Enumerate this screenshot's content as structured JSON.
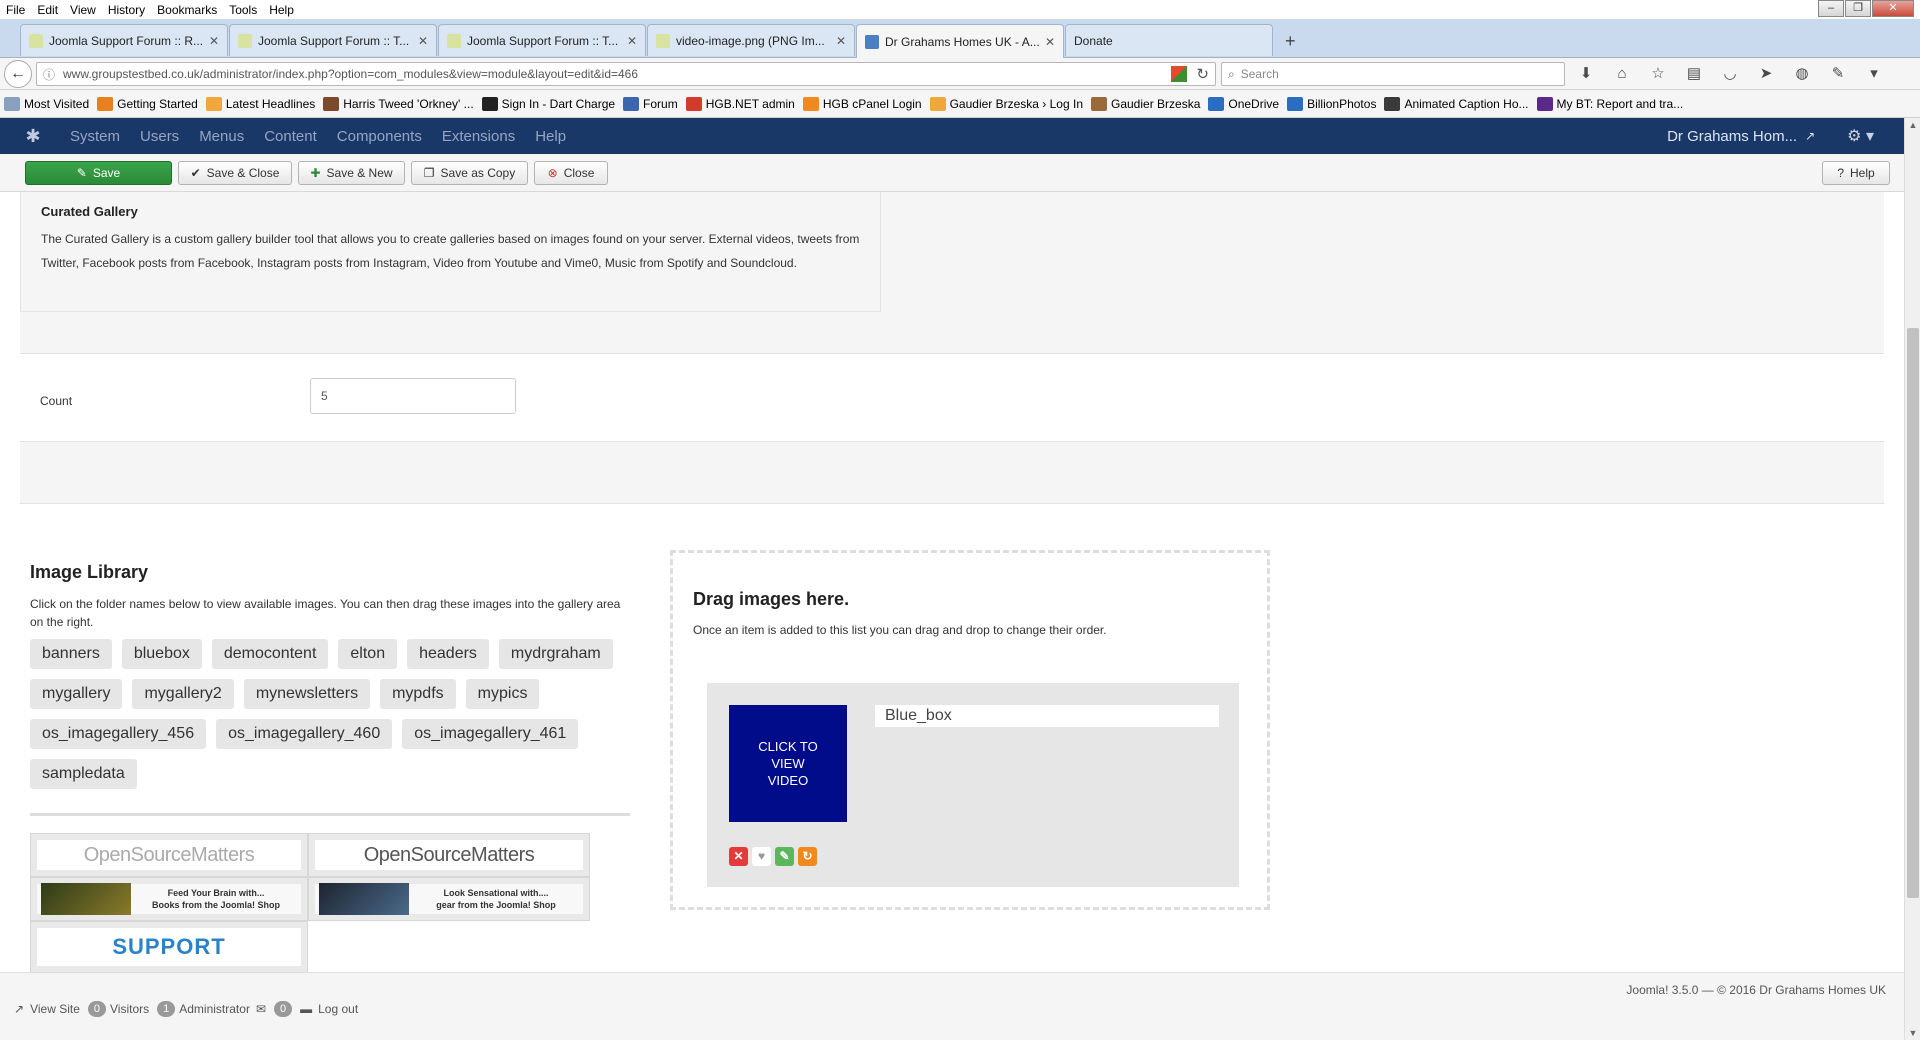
{
  "menubar": [
    "File",
    "Edit",
    "View",
    "History",
    "Bookmarks",
    "Tools",
    "Help"
  ],
  "tabs": [
    {
      "label": "Joomla Support Forum :: R...",
      "color": "#d8e3a2"
    },
    {
      "label": "Joomla Support Forum :: T...",
      "color": "#d8e3a2"
    },
    {
      "label": "Joomla Support Forum :: T...",
      "color": "#d8e3a2"
    },
    {
      "label": "video-image.png (PNG Im...",
      "color": "#d8e3a2"
    },
    {
      "label": "Dr Grahams Homes UK - A...",
      "color": "#4a7fc1"
    },
    {
      "label": "Donate",
      "color": "#f5f5f5"
    }
  ],
  "nav": {
    "url": "www.groupstestbed.co.uk/administrator/index.php?option=com_modules&view=module&layout=edit&id=466",
    "search_placeholder": "Search"
  },
  "bookmarks": [
    {
      "label": "Most Visited",
      "color": "#8aa0c0"
    },
    {
      "label": "Getting Started",
      "color": "#e5811f"
    },
    {
      "label": "Latest Headlines",
      "color": "#f0a73b"
    },
    {
      "label": "Harris Tweed 'Orkney' ...",
      "color": "#7a4a2a"
    },
    {
      "label": "Sign In - Dart Charge",
      "color": "#222222"
    },
    {
      "label": "Forum",
      "color": "#3a66b0"
    },
    {
      "label": "HGB.NET admin",
      "color": "#d33a2c"
    },
    {
      "label": "HGB cPanel Login",
      "color": "#f08a1f"
    },
    {
      "label": "Gaudier Brzeska › Log In",
      "color": "#f0a73b"
    },
    {
      "label": "Gaudier Brzeska",
      "color": "#9a6a3a"
    },
    {
      "label": "OneDrive",
      "color": "#2b6dc4"
    },
    {
      "label": "BillionPhotos",
      "color": "#2b6dc4"
    },
    {
      "label": "Animated Caption Ho...",
      "color": "#3a3a3a"
    },
    {
      "label": "My BT: Report and tra...",
      "color": "#5a2a8a"
    }
  ],
  "jheader": {
    "menu": [
      "System",
      "Users",
      "Menus",
      "Content",
      "Components",
      "Extensions",
      "Help"
    ],
    "site_name": "Dr Grahams Hom..."
  },
  "toolbar": {
    "save": "Save",
    "save_close": "Save & Close",
    "save_new": "Save & New",
    "save_copy": "Save as Copy",
    "close": "Close",
    "help": "Help"
  },
  "description": {
    "title": "Curated Gallery",
    "text": "The Curated Gallery is a custom gallery builder tool that allows you to create galleries based on images found on your server. External videos, tweets from Twitter, Facebook posts from Facebook, Instagram posts from Instagram, Video from Youtube and Vime0, Music from Spotify and Soundcloud."
  },
  "count": {
    "label": "Count",
    "value": "5"
  },
  "library": {
    "title": "Image Library",
    "description": "Click on the folder names below to view available images. You can then drag these images into the gallery area on the right.",
    "folders": [
      "banners",
      "bluebox",
      "democontent",
      "elton",
      "headers",
      "mydrgraham",
      "mygallery",
      "mygallery2",
      "mynewsletters",
      "mypdfs",
      "mypics",
      "os_imagegallery_456",
      "os_imagegallery_460",
      "os_imagegallery_461",
      "sampledata"
    ],
    "thumbs": {
      "osm": "OpenSourceMatters",
      "banner1_line1": "Feed Your Brain with...",
      "banner1_line2": "Books from the Joomla! Shop",
      "banner2_line1": "Look Sensational with....",
      "banner2_line2": "gear from the Joomla! Shop",
      "support": "SUPPORT"
    }
  },
  "dropzone": {
    "title": "Drag images here.",
    "description": "Once an item is added to this list you can drag and drop to change their order.",
    "item_thumb_text": "CLICK TO VIEW VIDEO",
    "item_title": "Blue_box"
  },
  "status": {
    "view_site": "View Site",
    "visitors_count": "0",
    "visitors": "Visitors",
    "admin_count": "1",
    "administrator": "Administrator",
    "messages_count": "0",
    "logout": "Log out",
    "footer": "Joomla! 3.5.0 — © 2016 Dr Grahams Homes UK"
  }
}
